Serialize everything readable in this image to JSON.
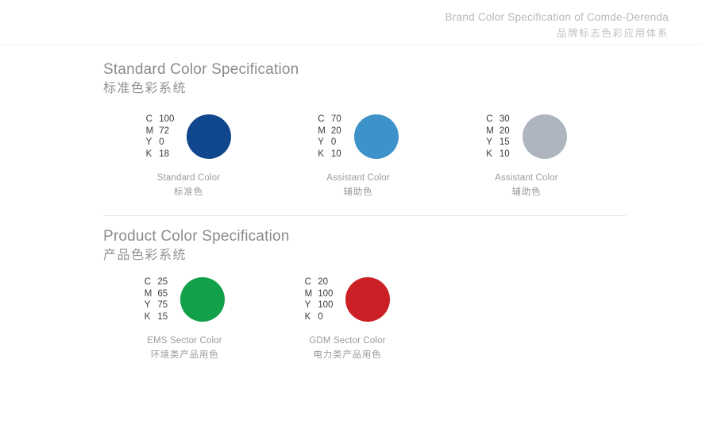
{
  "header": {
    "title_en": "Brand Color Specification of Comde-Derenda",
    "title_cn": "品牌标志色彩应用体系"
  },
  "sections": [
    {
      "title_en": "Standard Color Specification",
      "title_cn": "标准色彩系统",
      "swatches": [
        {
          "hex": "#10468C",
          "caption_en": "Standard Color",
          "caption_cn": "标准色",
          "cmyk": [
            {
              "key": "C",
              "value": "100"
            },
            {
              "key": "M",
              "value": "72"
            },
            {
              "key": "Y",
              "value": "0"
            },
            {
              "key": "K",
              "value": "18"
            }
          ]
        },
        {
          "hex": "#3D93C9",
          "caption_en": "Assistant Color",
          "caption_cn": "辅助色",
          "cmyk": [
            {
              "key": "C",
              "value": "70"
            },
            {
              "key": "M",
              "value": "20"
            },
            {
              "key": "Y",
              "value": "0"
            },
            {
              "key": "K",
              "value": "10"
            }
          ]
        },
        {
          "hex": "#AEB5BE",
          "caption_en": "Assistant Color",
          "caption_cn": "辅助色",
          "cmyk": [
            {
              "key": "C",
              "value": "30"
            },
            {
              "key": "M",
              "value": "20"
            },
            {
              "key": "Y",
              "value": "15"
            },
            {
              "key": "K",
              "value": "10"
            }
          ]
        }
      ]
    },
    {
      "title_en": "Product Color Specification",
      "title_cn": "产品色彩系统",
      "swatches": [
        {
          "hex": "#12A04A",
          "caption_en": "EMS Sector Color",
          "caption_cn": "环境类产品用色",
          "cmyk": [
            {
              "key": "C",
              "value": "25"
            },
            {
              "key": "M",
              "value": "65"
            },
            {
              "key": "Y",
              "value": "75"
            },
            {
              "key": "K",
              "value": "15"
            }
          ]
        },
        {
          "hex": "#CB2026",
          "caption_en": "GDM Sector Color",
          "caption_cn": "电力类产品用色",
          "cmyk": [
            {
              "key": "C",
              "value": "20"
            },
            {
              "key": "M",
              "value": "100"
            },
            {
              "key": "Y",
              "value": "100"
            },
            {
              "key": "K",
              "value": "0"
            }
          ]
        }
      ]
    }
  ]
}
